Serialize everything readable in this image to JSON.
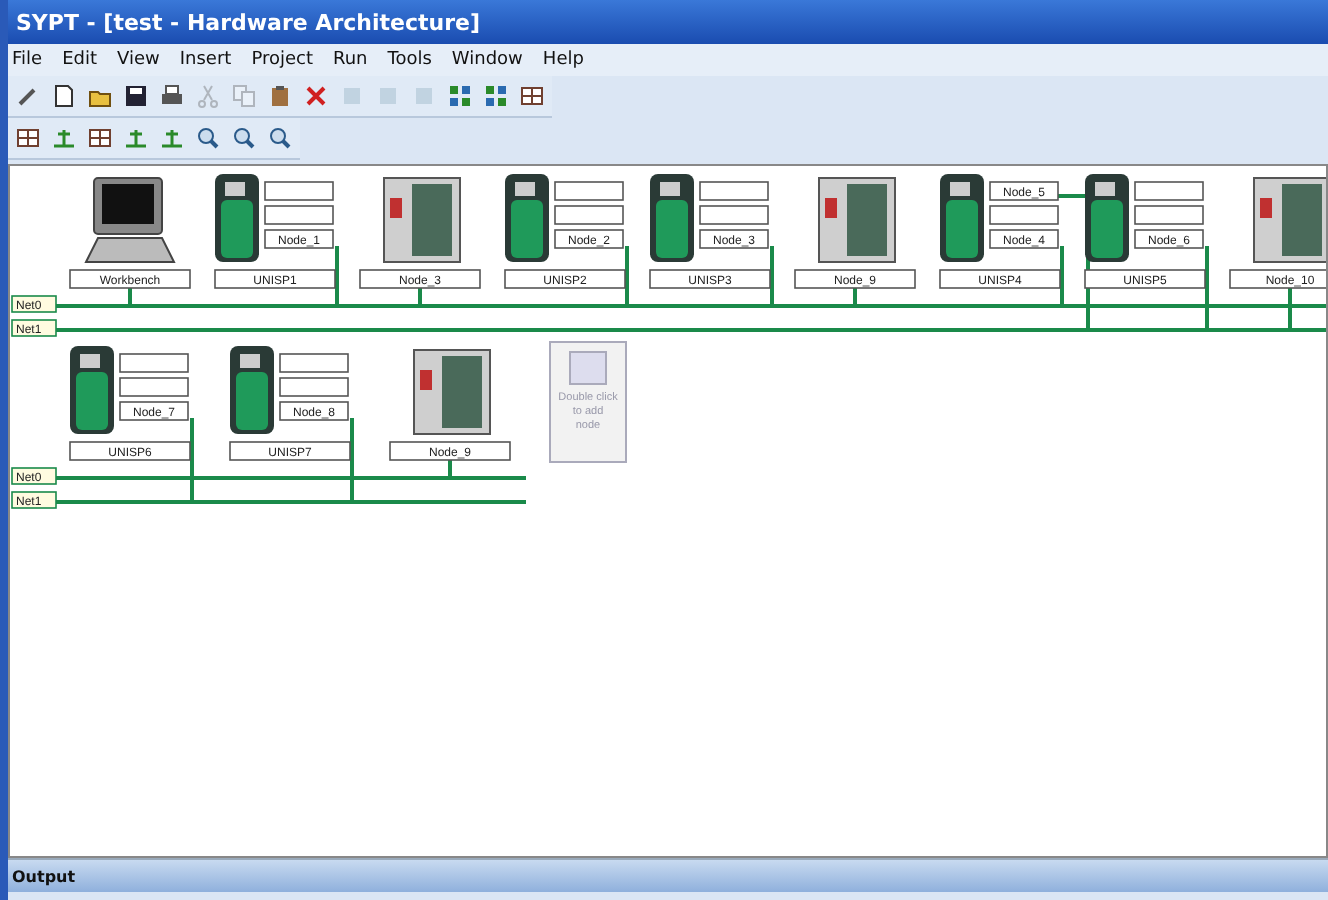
{
  "window": {
    "title": "SYPT - [test - Hardware Architecture]"
  },
  "menu": [
    "File",
    "Edit",
    "View",
    "Insert",
    "Project",
    "Run",
    "Tools",
    "Window",
    "Help"
  ],
  "toolbars": [
    [
      {
        "kind": "wand",
        "disabled": false
      },
      {
        "kind": "new",
        "disabled": false
      },
      {
        "kind": "open",
        "disabled": false
      },
      {
        "kind": "save",
        "disabled": false
      },
      {
        "kind": "print",
        "disabled": false
      },
      {
        "kind": "cut",
        "disabled": true
      },
      {
        "kind": "copy",
        "disabled": true
      },
      {
        "kind": "paste",
        "disabled": false
      },
      {
        "kind": "delete",
        "disabled": false
      },
      {
        "kind": "doc",
        "disabled": true
      },
      {
        "kind": "doc",
        "disabled": true
      },
      {
        "kind": "doc",
        "disabled": true
      },
      {
        "kind": "grid",
        "disabled": false
      },
      {
        "kind": "grid",
        "disabled": false
      },
      {
        "kind": "table",
        "disabled": false
      }
    ],
    [
      {
        "kind": "table",
        "disabled": false
      },
      {
        "kind": "bus",
        "disabled": false
      },
      {
        "kind": "table",
        "disabled": false
      },
      {
        "kind": "bus",
        "disabled": false
      },
      {
        "kind": "bus",
        "disabled": false
      },
      {
        "kind": "zoom",
        "disabled": false
      },
      {
        "kind": "zoom",
        "disabled": false
      },
      {
        "kind": "zoom",
        "disabled": false
      }
    ]
  ],
  "diagram": {
    "rows": [
      {
        "networks": [
          "Net0",
          "Net1"
        ],
        "nodes": [
          {
            "kind": "pc",
            "label": "Workbench",
            "lower_net": false
          },
          {
            "kind": "drive",
            "label": "UNISP1",
            "bottom_slot": "Node_1",
            "lower_net": false
          },
          {
            "kind": "controller",
            "label": "Node_3",
            "lower_net": false
          },
          {
            "kind": "drive",
            "label": "UNISP2",
            "bottom_slot": "Node_2",
            "lower_net": false
          },
          {
            "kind": "drive",
            "label": "UNISP3",
            "bottom_slot": "Node_3",
            "lower_net": false
          },
          {
            "kind": "controller",
            "label": "Node_9",
            "lower_net": false
          },
          {
            "kind": "drive",
            "label": "UNISP4",
            "top_slot": "Node_5",
            "bottom_slot": "Node_4",
            "lower_net": false,
            "top_lower_net": true
          },
          {
            "kind": "drive",
            "label": "UNISP5",
            "bottom_slot": "Node_6",
            "lower_net": true
          },
          {
            "kind": "controller",
            "label": "Node_10",
            "lower_net": true
          }
        ]
      },
      {
        "networks": [
          "Net0",
          "Net1"
        ],
        "nodes": [
          {
            "kind": "drive",
            "label": "UNISP6",
            "bottom_slot": "Node_7",
            "lower_net": true
          },
          {
            "kind": "drive",
            "label": "UNISP7",
            "bottom_slot": "Node_8",
            "lower_net": true
          },
          {
            "kind": "controller",
            "label": "Node_9",
            "lower_net": false
          },
          {
            "kind": "add",
            "label": "Double click to add node",
            "disabled": true
          }
        ]
      }
    ]
  },
  "output": {
    "title": "Output"
  }
}
